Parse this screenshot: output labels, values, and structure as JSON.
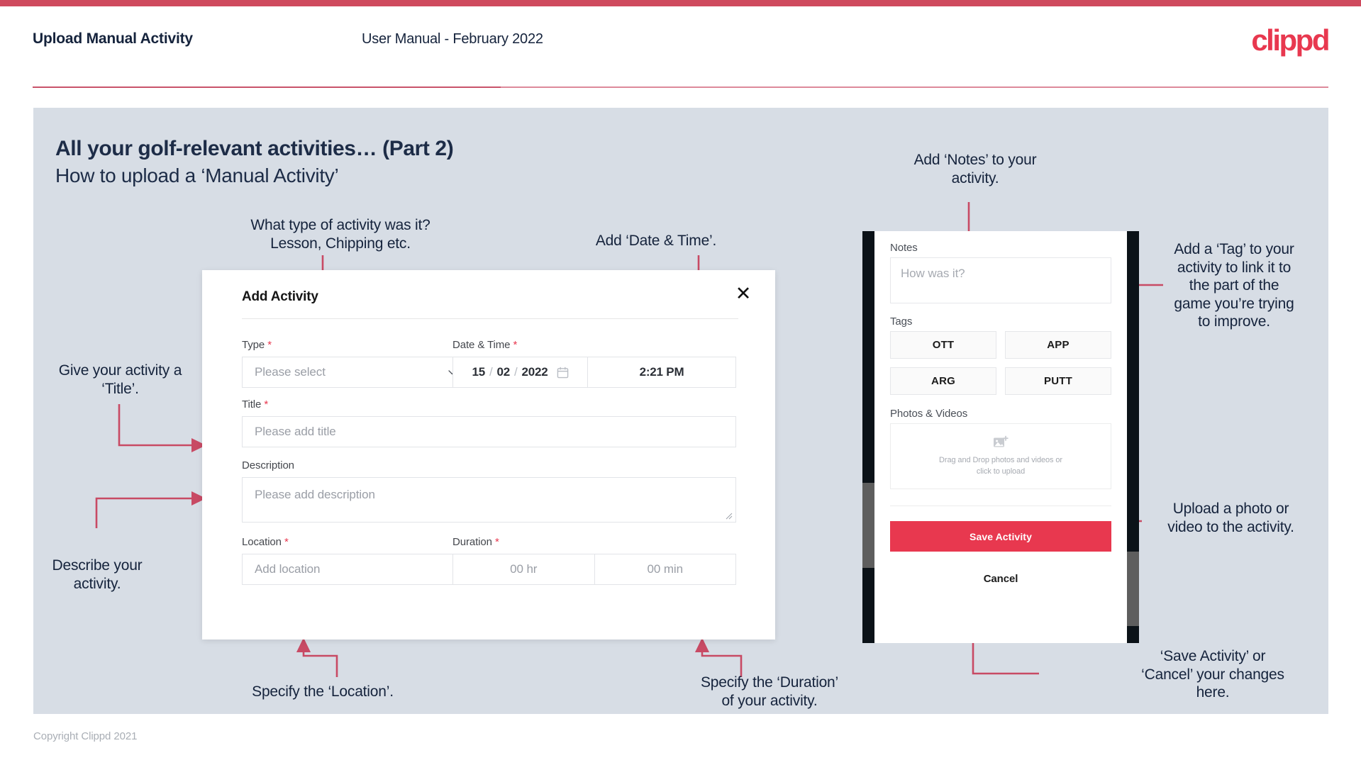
{
  "header": {
    "title": "Upload Manual Activity",
    "subtitle": "User Manual - February 2022",
    "logo": "clippd"
  },
  "slide": {
    "title": "All your golf-relevant activities… (Part 2)",
    "subtitle": "How to upload a ‘Manual Activity’"
  },
  "annotations": {
    "type": "What type of activity was it?\nLesson, Chipping etc.",
    "datetime": "Add ‘Date & Time’.",
    "title": "Give your activity a\n‘Title’.",
    "description": "Describe your\nactivity.",
    "location": "Specify the ‘Location’.",
    "duration": "Specify the ‘Duration’\nof your activity.",
    "notes": "Add ‘Notes’ to your\nactivity.",
    "tags": "Add a ‘Tag’ to your\nactivity to link it to\nthe part of the\ngame you’re trying\nto improve.",
    "photos": "Upload a photo or\nvideo to the activity.",
    "save": "‘Save Activity’ or\n‘Cancel’ your changes\nhere."
  },
  "dialog": {
    "title": "Add Activity",
    "close_icon": "close-icon",
    "fields": {
      "type": {
        "label": "Type",
        "required": "*",
        "placeholder": "Please select",
        "chevron_icon": "chevron-down-icon"
      },
      "datetime": {
        "label": "Date & Time",
        "required": "*",
        "day": "15",
        "month": "02",
        "year": "2022",
        "sep": "/",
        "calendar_icon": "calendar-icon",
        "time": "2:21 PM"
      },
      "title": {
        "label": "Title",
        "required": "*",
        "placeholder": "Please add title"
      },
      "description": {
        "label": "Description",
        "required": "",
        "placeholder": "Please add description"
      },
      "location": {
        "label": "Location",
        "required": "*",
        "placeholder": "Add location"
      },
      "duration": {
        "label": "Duration",
        "required": "*",
        "hours": "00 hr",
        "minutes": "00 min"
      }
    }
  },
  "phone": {
    "notes": {
      "label": "Notes",
      "placeholder": "How was it?"
    },
    "tags": {
      "label": "Tags",
      "items": [
        "OTT",
        "APP",
        "ARG",
        "PUTT"
      ]
    },
    "photos": {
      "label": "Photos & Videos",
      "icon": "add-image-icon",
      "drop_line1": "Drag and Drop photos and videos or",
      "drop_line2": "click to upload"
    },
    "save_label": "Save Activity",
    "cancel_label": "Cancel"
  },
  "footer": {
    "copyright": "Copyright Clippd 2021"
  },
  "colors": {
    "brand_pink": "#e8384f",
    "bar_red": "#cf4a5e",
    "slide_bg": "#d7dde5",
    "ink": "#15233c",
    "connector": "#c84a64"
  }
}
